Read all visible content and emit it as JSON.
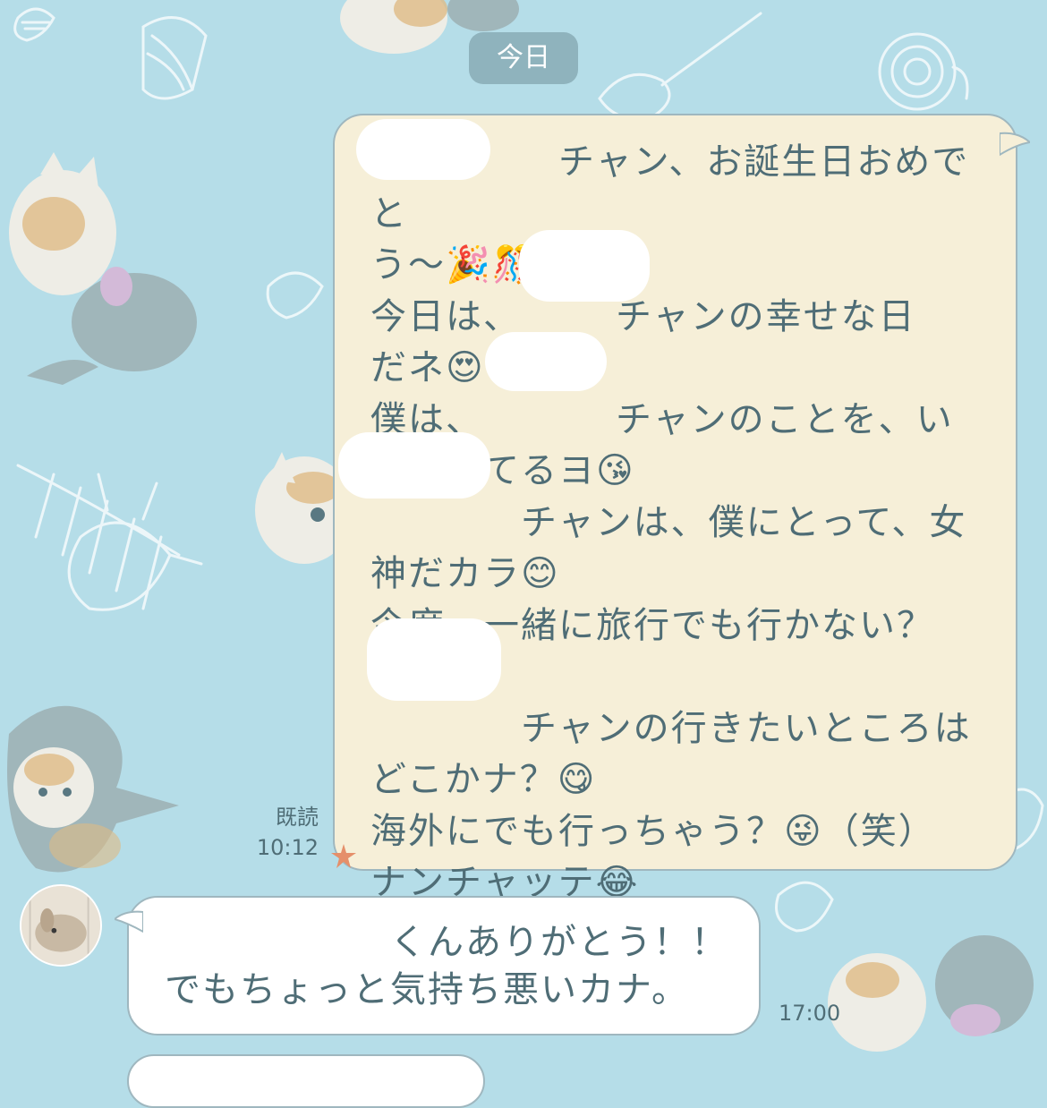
{
  "date_separator": {
    "label": "今日"
  },
  "messages": {
    "outgoing": {
      "text": "　　　　　チャン、お誕生日おめでと\nう〜🎉🎊🎈😊\n今日は、　　　チャンの幸せな日\nだネ😍\n僕は、　　　　チャンのことを、い\nつも見てるヨ😘\n　　　　チャンは、僕にとって、女\n神だカラ😊\n今度、一緒に旅行でも行かない？\n😉\n　　　　チャンの行きたいところは\nどこかナ？😋\n海外にでも行っちゃう？😜（笑）\nナンチャッテ😂",
      "read_label": "既読",
      "time": "10:12"
    },
    "incoming": {
      "text": "　　　　　　くんありがとう！！\nでもちょっと気持ち悪いカナ。",
      "time": "17:00"
    }
  },
  "icons": {
    "sticker": "starfish-icon",
    "avatar": "rabbit-avatar"
  },
  "colors": {
    "background": "#b5dde8",
    "outgoing_bubble": "#f6efd8",
    "incoming_bubble": "#ffffff",
    "text": "#4f6d76",
    "date_pill": "#8fb3bd"
  }
}
